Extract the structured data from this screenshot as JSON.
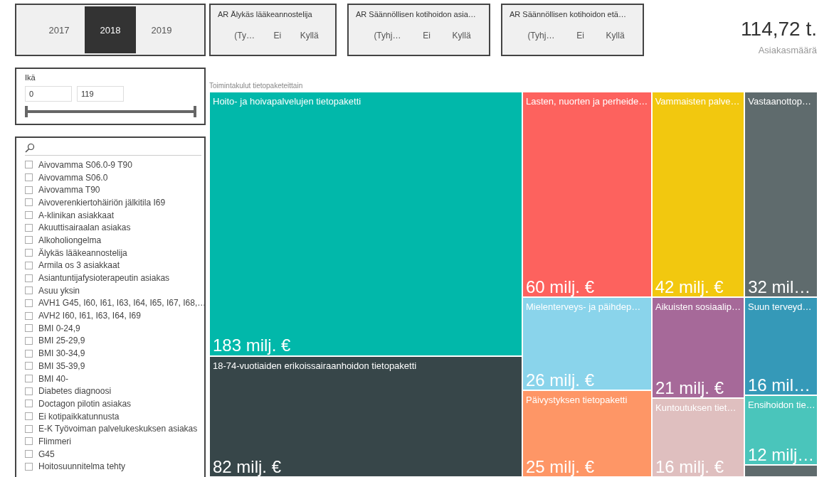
{
  "year_slicer": {
    "years": [
      {
        "label": "2017",
        "selected": false
      },
      {
        "label": "2018",
        "selected": true
      },
      {
        "label": "2019",
        "selected": false
      }
    ]
  },
  "filters": [
    {
      "title": "AR Älykäs lääkeannostelija",
      "options": [
        "(Ty…",
        "Ei",
        "Kyllä"
      ]
    },
    {
      "title": "AR Säännöllisen kotihoidon asia…",
      "options": [
        "(Tyhj…",
        "Ei",
        "Kyllä"
      ]
    },
    {
      "title": "AR Säännöllisen kotihoidon etä…",
      "options": [
        "(Tyhj…",
        "Ei",
        "Kyllä"
      ]
    }
  ],
  "kpi": {
    "value": "114,72 t.",
    "label": "Asiakasmäärä"
  },
  "age_slicer": {
    "title": "Ikä",
    "min": "0",
    "max": "119",
    "range": {
      "level": 1
    }
  },
  "list_slicer": {
    "items": [
      {
        "label": "Aivovamma S06.0-9 T90",
        "checked": false
      },
      {
        "label": "Aivovamma S06.0",
        "checked": false
      },
      {
        "label": "Aivovamma T90",
        "checked": false
      },
      {
        "label": "Aivoverenkiertohäiriön jälkitila I69",
        "checked": false
      },
      {
        "label": "A-klinikan asiakkaat",
        "checked": false
      },
      {
        "label": "Akuuttisairaalan asiakas",
        "checked": false
      },
      {
        "label": "Alkoholiongelma",
        "checked": false
      },
      {
        "label": "Älykäs lääkeannostelija",
        "checked": false
      },
      {
        "label": "Armila os 3 asiakkaat",
        "checked": false
      },
      {
        "label": "Asiantuntijafysioterapeutin asiakas",
        "checked": false
      },
      {
        "label": "Asuu yksin",
        "checked": false
      },
      {
        "label": "AVH1 G45, I60, I61, I63, I64, I65, I67, I68,…",
        "checked": false
      },
      {
        "label": "AVH2 I60, I61, I63, I64, I69",
        "checked": false
      },
      {
        "label": "BMI 0-24,9",
        "checked": false
      },
      {
        "label": "BMI 25-29,9",
        "checked": false
      },
      {
        "label": "BMI 30-34,9",
        "checked": false
      },
      {
        "label": "BMI 35-39,9",
        "checked": false
      },
      {
        "label": "BMI 40-",
        "checked": false
      },
      {
        "label": "Diabetes diagnoosi",
        "checked": false
      },
      {
        "label": "Doctagon pilotin asiakas",
        "checked": false
      },
      {
        "label": "Ei kotipaikkatunnusta",
        "checked": false
      },
      {
        "label": "E-K Työvoiman palvelukeskuksen asiakas",
        "checked": false
      },
      {
        "label": "Flimmeri",
        "checked": false
      },
      {
        "label": "G45",
        "checked": false
      },
      {
        "label": "Hoitosuunnitelma tehty",
        "checked": false
      }
    ]
  },
  "treemap": {
    "title": "Toimintakulut tietopaketeittain",
    "tiles": [
      {
        "label": "Hoito- ja hoivapalvelujen tietopaketti",
        "amount": "183 milj. €",
        "color": "#01b8aa"
      },
      {
        "label": "18-74-vuotiaiden erikoissairaanhoidon tietopaketti",
        "amount": "82 milj. €",
        "color": "#374649"
      },
      {
        "label": "Lasten, nuorten ja perheide…",
        "amount": "60 milj. €",
        "color": "#fd625e"
      },
      {
        "label": "Vammaisten palve…",
        "amount": "42 milj. €",
        "color": "#f2c80f"
      },
      {
        "label": "Vastaanottop…",
        "amount": "32 mil…",
        "color": "#5f6b6d"
      },
      {
        "label": "Mielenterveys- ja päihdep…",
        "amount": "26 milj. €",
        "color": "#8ad4eb"
      },
      {
        "label": "Päivystyksen tietopaketti",
        "amount": "25 milj. €",
        "color": "#fe9666"
      },
      {
        "label": "Aikuisten sosiaalip…",
        "amount": "21 milj. €",
        "color": "#a66999"
      },
      {
        "label": "Kuntoutuksen tiet…",
        "amount": "16 milj. €",
        "color": "#dfbfbf"
      },
      {
        "label": "Suun terveyd…",
        "amount": "16 mil…",
        "color": "#3599b8"
      },
      {
        "label": "Ensihoidon tie…",
        "amount": "12 milj…",
        "color": "#4ac5bb"
      },
      {
        "color": "#5f6b6d"
      }
    ]
  }
}
